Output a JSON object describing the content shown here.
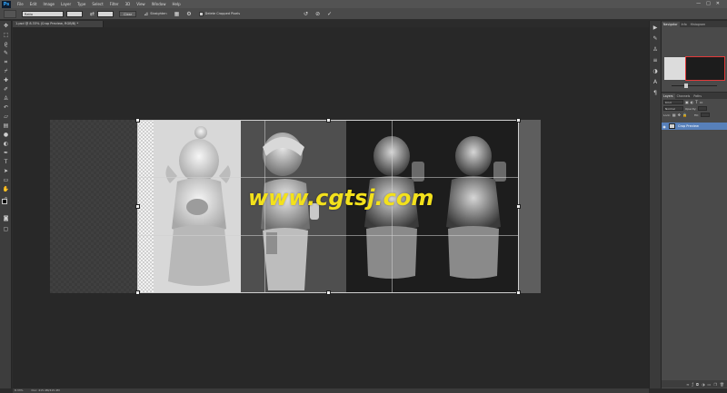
{
  "app": {
    "logo": "Ps",
    "menu": [
      "File",
      "Edit",
      "Image",
      "Layer",
      "Type",
      "Select",
      "Filter",
      "3D",
      "View",
      "Window",
      "Help"
    ],
    "window_controls": [
      "—",
      "□",
      "✕"
    ]
  },
  "options_bar": {
    "ratio_select": "Ratio",
    "clear_label": "Clear",
    "straighten_label": "Straighten",
    "delete_cropped_label": "Delete Cropped Pixels"
  },
  "document": {
    "tab_title": "1.psd @ 8.33% (Crop Preview, RGB/8) *",
    "watermark": "www.cgtsj.com"
  },
  "panels": {
    "navigator_tabs": [
      "Navigator",
      "Info",
      "Histogram"
    ],
    "layers_tabs": [
      "Layers",
      "Channels",
      "Paths"
    ],
    "kind_label": "Kind",
    "blend_mode": "Normal",
    "opacity_label": "Opacity:",
    "lock_label": "Lock:",
    "fill_label": "Fill:",
    "layer_name": "Crop Preview"
  },
  "status": {
    "zoom": "8.33%",
    "doc_size": "Doc: 415.4M/415.4M"
  },
  "colors": {
    "accent": "#5780ba",
    "watermark": "#f3e11c",
    "navigator_frame": "#e23a3a"
  }
}
